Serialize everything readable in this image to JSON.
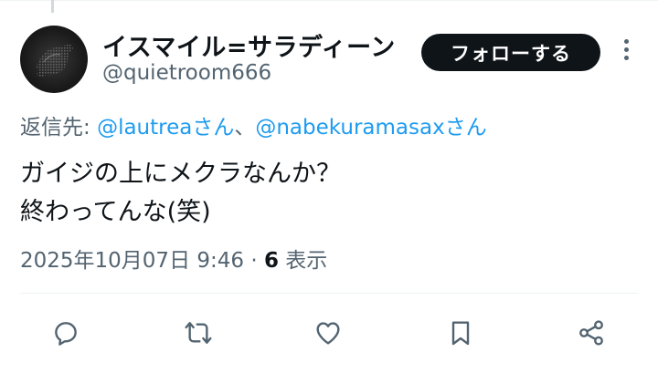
{
  "user": {
    "display_name": "イスマイル=サラディーン",
    "handle": "@quietroom666"
  },
  "follow_label": "フォローする",
  "reply_to": {
    "prefix": "返信先: ",
    "mention_1": "@lautreaさん",
    "separator": "、",
    "mention_2": "@nabekuramasaxさん"
  },
  "tweet": {
    "line_1": "ガイジの上にメクラなんか？",
    "line_2": "終わってんな(笑)"
  },
  "meta": {
    "datetime": "2025年10月07日 9:46",
    "dot": " · ",
    "views_count": "6",
    "views_label": " 表示"
  },
  "icons": {
    "reply": "reply-icon",
    "retweet": "retweet-icon",
    "like": "heart-icon",
    "bookmark": "bookmark-icon",
    "share": "share-icon",
    "more": "more-vertical-icon"
  },
  "colors": {
    "text": "#0f1419",
    "secondary": "#536471",
    "mention": "#1d9bf0",
    "button_bg": "#0f1419"
  }
}
